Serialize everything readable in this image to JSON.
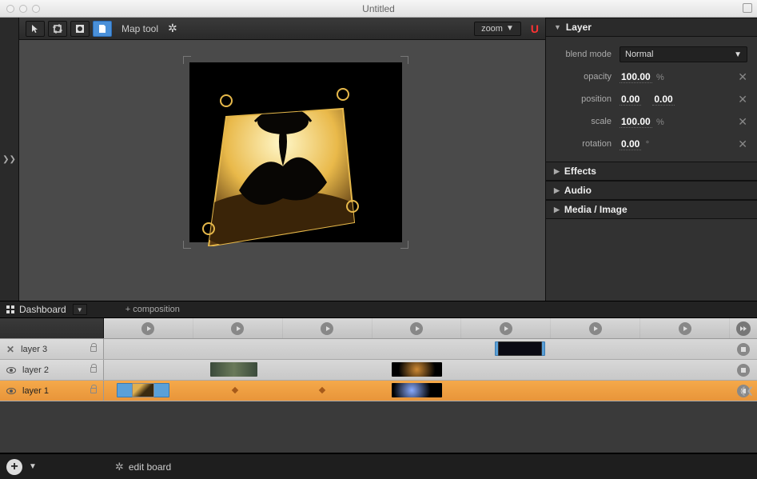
{
  "window": {
    "title": "Untitled"
  },
  "toolbar": {
    "map_tool_label": "Map tool",
    "zoom_label": "zoom"
  },
  "inspector": {
    "panels": {
      "layer": "Layer",
      "effects": "Effects",
      "audio": "Audio",
      "media": "Media / Image"
    },
    "layer": {
      "blend_mode_label": "blend mode",
      "blend_mode_value": "Normal",
      "opacity_label": "opacity",
      "opacity_value": "100.00",
      "opacity_unit": "%",
      "position_label": "position",
      "position_x": "0.00",
      "position_y": "0.00",
      "scale_label": "scale",
      "scale_value": "100.00",
      "scale_unit": "%",
      "rotation_label": "rotation",
      "rotation_value": "0.00",
      "rotation_unit": "°"
    }
  },
  "dashboard": {
    "tab_label": "Dashboard",
    "composition_label": "+  composition"
  },
  "timeline": {
    "tracks": [
      {
        "name": "layer 3",
        "visible": false,
        "selected": false
      },
      {
        "name": "layer 2",
        "visible": true,
        "selected": false
      },
      {
        "name": "layer 1",
        "visible": true,
        "selected": true
      }
    ]
  },
  "bottom": {
    "edit_board_label": "edit board"
  }
}
